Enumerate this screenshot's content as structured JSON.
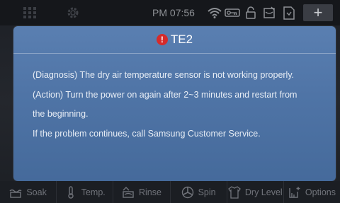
{
  "status_bar": {
    "time": "PM 07:56",
    "icons": [
      "grid-icon",
      "gear-icon",
      "wifi-icon",
      "key-icon",
      "lock-icon",
      "door-icon",
      "document-icon"
    ],
    "add_label": "+"
  },
  "dialog": {
    "title": "TE2",
    "icon": "warning-icon",
    "lines": [
      "(Diagnosis) The dry air temperature sensor is not working properly.",
      "(Action) Turn the power on again after 2~3 minutes and restart from",
      "the beginning.",
      "If the problem continues, call Samsung Customer Service."
    ]
  },
  "tabs": [
    {
      "label": "Soak",
      "icon": "soak-icon"
    },
    {
      "label": "Temp.",
      "icon": "thermometer-icon"
    },
    {
      "label": "Rinse",
      "icon": "rinse-icon"
    },
    {
      "label": "Spin",
      "icon": "spin-icon"
    },
    {
      "label": "Dry Level",
      "icon": "dry-level-icon"
    },
    {
      "label": "Options",
      "icon": "options-icon"
    }
  ],
  "colors": {
    "dialog_bg": "#5079ab",
    "warning": "#d62b2b",
    "tab_text": "#70737a"
  }
}
